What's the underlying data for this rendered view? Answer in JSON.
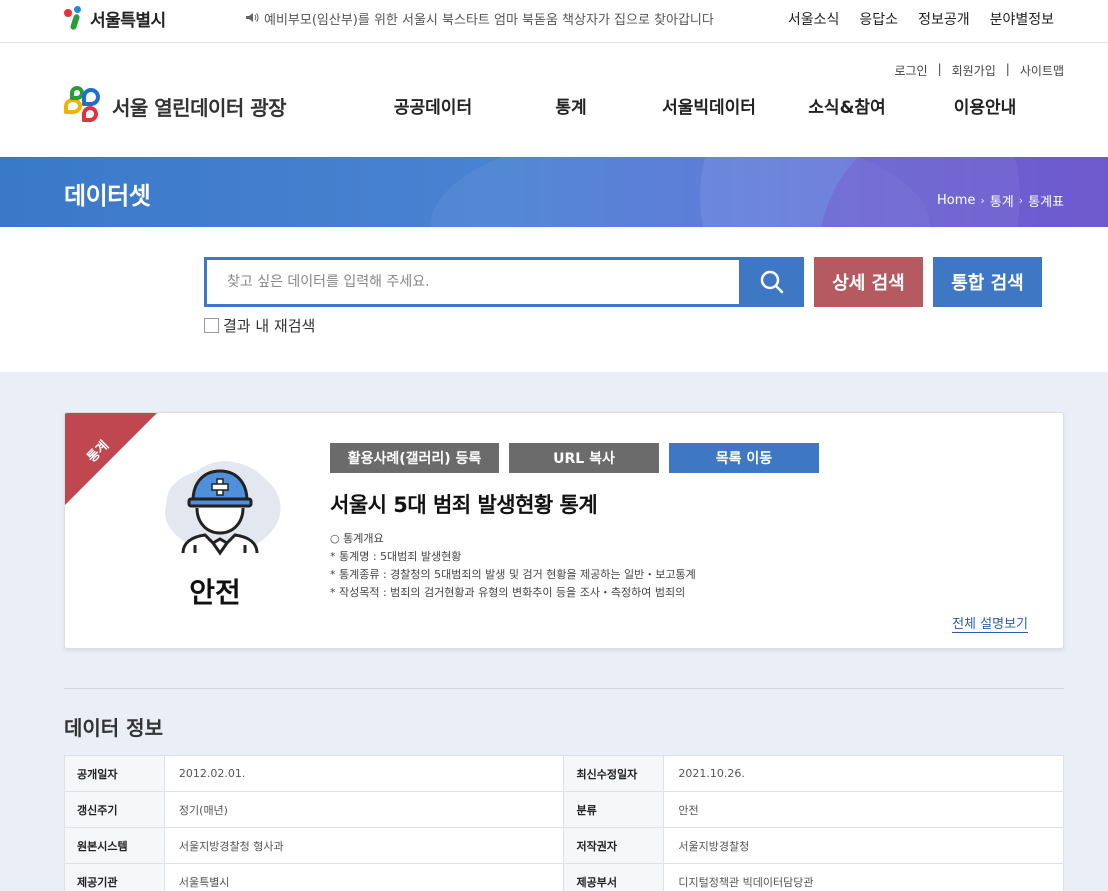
{
  "topbar": {
    "logo_text": "서울특별시",
    "notice": "예비부모(임산부)를 위한 서울시 북스타트 엄마 북돋움 책상자가 집으로 찾아갑니다",
    "nav": [
      "서울소식",
      "응답소",
      "정보공개",
      "분야별정보"
    ]
  },
  "header": {
    "util": [
      "로그인",
      "회원가입",
      "사이트맵"
    ],
    "brand": "서울 열린데이터 광장",
    "gnb": [
      "공공데이터",
      "통계",
      "서울빅데이터",
      "소식&참여",
      "이용안내"
    ]
  },
  "banner": {
    "title": "데이터셋",
    "breadcrumb": [
      "Home",
      "통계",
      "통계표"
    ]
  },
  "search": {
    "placeholder": "찾고 싶은 데이터를 입력해 주세요.",
    "value": "",
    "detail_label": "상세 검색",
    "total_label": "통합 검색",
    "research_label": "결과 내 재검색"
  },
  "card": {
    "ribbon": "통계",
    "category": "안전",
    "actions": {
      "gallery": "활용사례(갤러리) 등록",
      "url": "URL 복사",
      "list": "목록 이동"
    },
    "title": "서울시 5대 범죄 발생현황 통계",
    "desc": [
      "○ 통계개요",
      "* 통계명 : 5대범죄 발생현황",
      "* 통계종류 : 경찰청의 5대범죄의 발생 및 검거 현황을 제공하는 일반・보고통계",
      "* 작성목적 : 범죄의 검거현황과 유형의 변화추이 등을 조사・측정하여 범죄의"
    ],
    "more": "전체 설명보기"
  },
  "info": {
    "title": "데이터 정보",
    "rows": [
      {
        "k1": "공개일자",
        "v1": "2012.02.01.",
        "k2": "최신수정일자",
        "v2": "2021.10.26."
      },
      {
        "k1": "갱신주기",
        "v1": "정기(매년)",
        "k2": "분류",
        "v2": "안전"
      },
      {
        "k1": "원본시스템",
        "v1": "서울지방경찰청 형사과",
        "k2": "저작권자",
        "v2": "서울지방경찰청"
      },
      {
        "k1": "제공기관",
        "v1": "서울특별시",
        "k2": "제공부서",
        "v2": "디지털정책관 빅데이터담당관"
      }
    ]
  },
  "colors": {
    "primary": "#3e77c4",
    "detail_button": "#b55a61",
    "ribbon": "#c0474f",
    "gray_button": "#6b6b6b",
    "content_bg": "#eaeef6"
  }
}
